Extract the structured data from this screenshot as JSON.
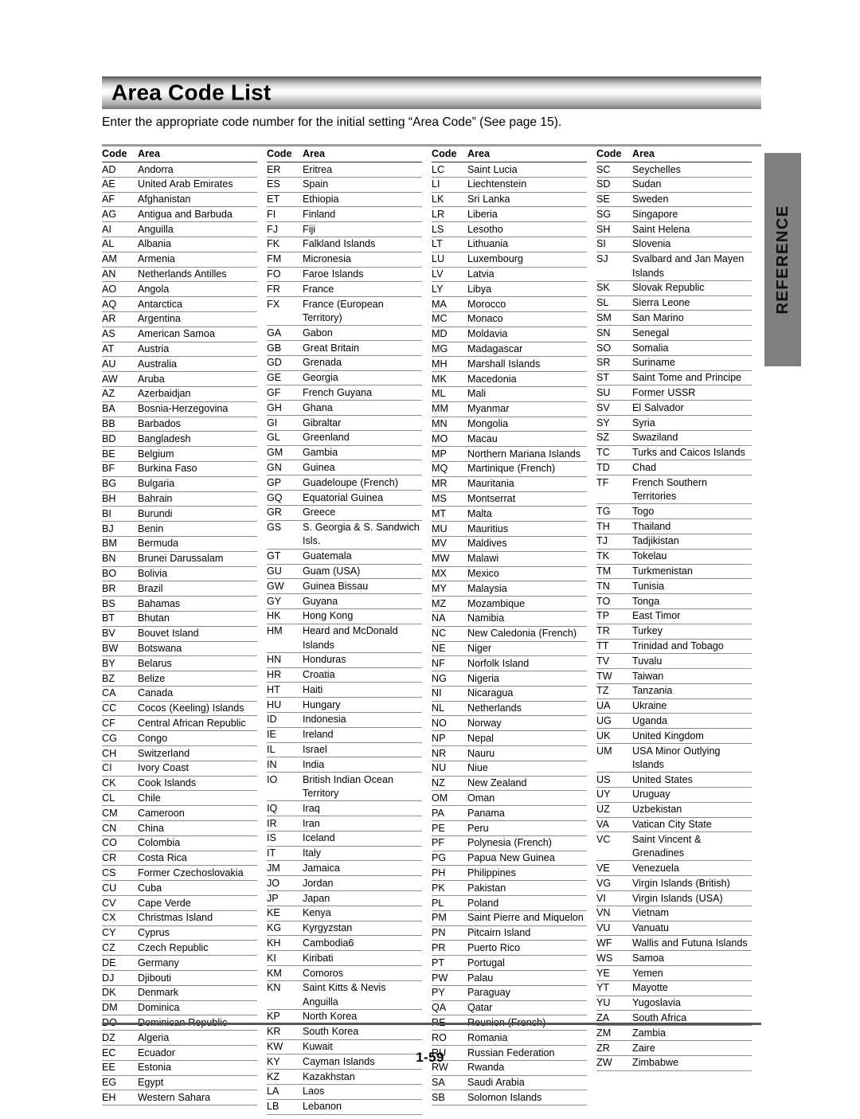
{
  "document": {
    "title": "Area Code List",
    "intro": "Enter the appropriate code number for the initial setting “Area Code” (See page 15).",
    "page_number": "1-59",
    "side_tab": "REFERENCE",
    "column_headers": {
      "code": "Code",
      "area": "Area"
    }
  },
  "columns": [
    {
      "rows": [
        {
          "code": "AD",
          "area": "Andorra"
        },
        {
          "code": "AE",
          "area": "United Arab Emirates"
        },
        {
          "code": "AF",
          "area": "Afghanistan"
        },
        {
          "code": "AG",
          "area": "Antigua and Barbuda"
        },
        {
          "code": "AI",
          "area": "Anguilla"
        },
        {
          "code": "AL",
          "area": "Albania"
        },
        {
          "code": "AM",
          "area": "Armenia"
        },
        {
          "code": "AN",
          "area": "Netherlands Antilles"
        },
        {
          "code": "AO",
          "area": "Angola"
        },
        {
          "code": "AQ",
          "area": "Antarctica"
        },
        {
          "code": "AR",
          "area": "Argentina"
        },
        {
          "code": "AS",
          "area": "American Samoa"
        },
        {
          "code": "AT",
          "area": "Austria"
        },
        {
          "code": "AU",
          "area": "Australia"
        },
        {
          "code": "AW",
          "area": "Aruba"
        },
        {
          "code": "AZ",
          "area": "Azerbaidjan"
        },
        {
          "code": "BA",
          "area": "Bosnia-Herzegovina"
        },
        {
          "code": "BB",
          "area": "Barbados"
        },
        {
          "code": "BD",
          "area": "Bangladesh"
        },
        {
          "code": "BE",
          "area": "Belgium"
        },
        {
          "code": "BF",
          "area": "Burkina Faso"
        },
        {
          "code": "BG",
          "area": "Bulgaria"
        },
        {
          "code": "BH",
          "area": "Bahrain"
        },
        {
          "code": "BI",
          "area": "Burundi"
        },
        {
          "code": "BJ",
          "area": "Benin"
        },
        {
          "code": "BM",
          "area": "Bermuda"
        },
        {
          "code": "BN",
          "area": "Brunei Darussalam"
        },
        {
          "code": "BO",
          "area": "Bolivia"
        },
        {
          "code": "BR",
          "area": "Brazil"
        },
        {
          "code": "BS",
          "area": "Bahamas"
        },
        {
          "code": "BT",
          "area": "Bhutan"
        },
        {
          "code": "BV",
          "area": "Bouvet Island"
        },
        {
          "code": "BW",
          "area": "Botswana"
        },
        {
          "code": "BY",
          "area": "Belarus"
        },
        {
          "code": "BZ",
          "area": "Belize"
        },
        {
          "code": "CA",
          "area": "Canada"
        },
        {
          "code": "CC",
          "area": "Cocos (Keeling) Islands"
        },
        {
          "code": "CF",
          "area": "Central African Republic"
        },
        {
          "code": "CG",
          "area": "Congo"
        },
        {
          "code": "CH",
          "area": "Switzerland"
        },
        {
          "code": "CI",
          "area": "Ivory Coast"
        },
        {
          "code": "CK",
          "area": "Cook Islands"
        },
        {
          "code": "CL",
          "area": "Chile"
        },
        {
          "code": "CM",
          "area": "Cameroon"
        },
        {
          "code": "CN",
          "area": "China"
        },
        {
          "code": "CO",
          "area": "Colombia"
        },
        {
          "code": "CR",
          "area": "Costa Rica"
        },
        {
          "code": "CS",
          "area": "Former Czechoslovakia"
        },
        {
          "code": "CU",
          "area": "Cuba"
        },
        {
          "code": "CV",
          "area": "Cape Verde"
        },
        {
          "code": "CX",
          "area": "Christmas Island"
        },
        {
          "code": "CY",
          "area": "Cyprus"
        },
        {
          "code": "CZ",
          "area": "Czech Republic"
        },
        {
          "code": "DE",
          "area": "Germany"
        },
        {
          "code": "DJ",
          "area": "Djibouti"
        },
        {
          "code": "DK",
          "area": "Denmark"
        },
        {
          "code": "DM",
          "area": "Dominica"
        },
        {
          "code": "DO",
          "area": "Dominican Republic"
        },
        {
          "code": "DZ",
          "area": "Algeria"
        },
        {
          "code": "EC",
          "area": "Ecuador"
        },
        {
          "code": "EE",
          "area": "Estonia"
        },
        {
          "code": "EG",
          "area": "Egypt"
        },
        {
          "code": "EH",
          "area": "Western Sahara"
        }
      ]
    },
    {
      "rows": [
        {
          "code": "ER",
          "area": "Eritrea"
        },
        {
          "code": "ES",
          "area": "Spain"
        },
        {
          "code": "ET",
          "area": "Ethiopia"
        },
        {
          "code": "FI",
          "area": "Finland"
        },
        {
          "code": "FJ",
          "area": "Fiji"
        },
        {
          "code": "FK",
          "area": "Falkland Islands"
        },
        {
          "code": "FM",
          "area": "Micronesia"
        },
        {
          "code": "FO",
          "area": "Faroe Islands"
        },
        {
          "code": "FR",
          "area": "France"
        },
        {
          "code": "FX",
          "area": "France (European Territory)"
        },
        {
          "code": "GA",
          "area": "Gabon"
        },
        {
          "code": "GB",
          "area": "Great Britain"
        },
        {
          "code": "GD",
          "area": "Grenada"
        },
        {
          "code": "GE",
          "area": "Georgia"
        },
        {
          "code": "GF",
          "area": "French Guyana"
        },
        {
          "code": "GH",
          "area": "Ghana"
        },
        {
          "code": "GI",
          "area": "Gibraltar"
        },
        {
          "code": "GL",
          "area": "Greenland"
        },
        {
          "code": "GM",
          "area": "Gambia"
        },
        {
          "code": "GN",
          "area": "Guinea"
        },
        {
          "code": "GP",
          "area": "Guadeloupe (French)"
        },
        {
          "code": "GQ",
          "area": "Equatorial Guinea"
        },
        {
          "code": "GR",
          "area": "Greece"
        },
        {
          "code": "GS",
          "area": "S. Georgia & S. Sandwich Isls."
        },
        {
          "code": "GT",
          "area": "Guatemala"
        },
        {
          "code": "GU",
          "area": "Guam (USA)"
        },
        {
          "code": "GW",
          "area": "Guinea Bissau"
        },
        {
          "code": "GY",
          "area": "Guyana"
        },
        {
          "code": "HK",
          "area": "Hong Kong"
        },
        {
          "code": "HM",
          "area": "Heard and McDonald Islands"
        },
        {
          "code": "HN",
          "area": "Honduras"
        },
        {
          "code": "HR",
          "area": "Croatia"
        },
        {
          "code": "HT",
          "area": "Haiti"
        },
        {
          "code": "HU",
          "area": "Hungary"
        },
        {
          "code": "ID",
          "area": "Indonesia"
        },
        {
          "code": "IE",
          "area": "Ireland"
        },
        {
          "code": "IL",
          "area": "Israel"
        },
        {
          "code": "IN",
          "area": "India"
        },
        {
          "code": "IO",
          "area": "British Indian Ocean Territory"
        },
        {
          "code": "IQ",
          "area": "Iraq"
        },
        {
          "code": "IR",
          "area": "Iran"
        },
        {
          "code": "IS",
          "area": "Iceland"
        },
        {
          "code": "IT",
          "area": "Italy"
        },
        {
          "code": "JM",
          "area": "Jamaica"
        },
        {
          "code": "JO",
          "area": "Jordan"
        },
        {
          "code": "JP",
          "area": "Japan"
        },
        {
          "code": "KE",
          "area": "Kenya"
        },
        {
          "code": "KG",
          "area": "Kyrgyzstan"
        },
        {
          "code": "KH",
          "area": "Cambodia6"
        },
        {
          "code": "KI",
          "area": "Kiribati"
        },
        {
          "code": "KM",
          "area": "Comoros"
        },
        {
          "code": "KN",
          "area": "Saint Kitts & Nevis Anguilla"
        },
        {
          "code": "KP",
          "area": "North Korea"
        },
        {
          "code": "KR",
          "area": "South Korea"
        },
        {
          "code": "KW",
          "area": "Kuwait"
        },
        {
          "code": "KY",
          "area": "Cayman Islands"
        },
        {
          "code": "KZ",
          "area": "Kazakhstan"
        },
        {
          "code": "LA",
          "area": "Laos"
        },
        {
          "code": "LB",
          "area": "Lebanon"
        }
      ]
    },
    {
      "rows": [
        {
          "code": "LC",
          "area": "Saint Lucia"
        },
        {
          "code": "LI",
          "area": "Liechtenstein"
        },
        {
          "code": "LK",
          "area": "Sri Lanka"
        },
        {
          "code": "LR",
          "area": "Liberia"
        },
        {
          "code": "LS",
          "area": "Lesotho"
        },
        {
          "code": "LT",
          "area": "Lithuania"
        },
        {
          "code": "LU",
          "area": "Luxembourg"
        },
        {
          "code": "LV",
          "area": "Latvia"
        },
        {
          "code": "LY",
          "area": "Libya"
        },
        {
          "code": "MA",
          "area": "Morocco"
        },
        {
          "code": "MC",
          "area": "Monaco"
        },
        {
          "code": "MD",
          "area": "Moldavia"
        },
        {
          "code": "MG",
          "area": "Madagascar"
        },
        {
          "code": "MH",
          "area": "Marshall Islands"
        },
        {
          "code": "MK",
          "area": "Macedonia"
        },
        {
          "code": "ML",
          "area": "Mali"
        },
        {
          "code": "MM",
          "area": "Myanmar"
        },
        {
          "code": "MN",
          "area": "Mongolia"
        },
        {
          "code": "MO",
          "area": "Macau"
        },
        {
          "code": "MP",
          "area": "Northern Mariana Islands"
        },
        {
          "code": "MQ",
          "area": "Martinique (French)"
        },
        {
          "code": "MR",
          "area": "Mauritania"
        },
        {
          "code": "MS",
          "area": "Montserrat"
        },
        {
          "code": "MT",
          "area": "Malta"
        },
        {
          "code": "MU",
          "area": "Mauritius"
        },
        {
          "code": "MV",
          "area": "Maldives"
        },
        {
          "code": "MW",
          "area": "Malawi"
        },
        {
          "code": "MX",
          "area": "Mexico"
        },
        {
          "code": "MY",
          "area": "Malaysia"
        },
        {
          "code": "MZ",
          "area": "Mozambique"
        },
        {
          "code": "NA",
          "area": "Namibia"
        },
        {
          "code": "NC",
          "area": "New Caledonia (French)"
        },
        {
          "code": "NE",
          "area": "Niger"
        },
        {
          "code": "NF",
          "area": "Norfolk Island"
        },
        {
          "code": "NG",
          "area": "Nigeria"
        },
        {
          "code": "NI",
          "area": "Nicaragua"
        },
        {
          "code": "NL",
          "area": "Netherlands"
        },
        {
          "code": "NO",
          "area": "Norway"
        },
        {
          "code": "NP",
          "area": "Nepal"
        },
        {
          "code": "NR",
          "area": "Nauru"
        },
        {
          "code": "NU",
          "area": "Niue"
        },
        {
          "code": "NZ",
          "area": "New Zealand"
        },
        {
          "code": "OM",
          "area": "Oman"
        },
        {
          "code": "PA",
          "area": "Panama"
        },
        {
          "code": "PE",
          "area": "Peru"
        },
        {
          "code": "PF",
          "area": "Polynesia (French)"
        },
        {
          "code": "PG",
          "area": "Papua New Guinea"
        },
        {
          "code": "PH",
          "area": "Philippines"
        },
        {
          "code": "PK",
          "area": "Pakistan"
        },
        {
          "code": "PL",
          "area": "Poland"
        },
        {
          "code": "PM",
          "area": "Saint Pierre and Miquelon"
        },
        {
          "code": "PN",
          "area": "Pitcairn Island"
        },
        {
          "code": "PR",
          "area": "Puerto Rico"
        },
        {
          "code": "PT",
          "area": "Portugal"
        },
        {
          "code": "PW",
          "area": "Palau"
        },
        {
          "code": "PY",
          "area": "Paraguay"
        },
        {
          "code": "QA",
          "area": "Qatar"
        },
        {
          "code": "RE",
          "area": "Reunion (French)"
        },
        {
          "code": "RO",
          "area": "Romania"
        },
        {
          "code": "RU",
          "area": "Russian Federation"
        },
        {
          "code": "RW",
          "area": "Rwanda"
        },
        {
          "code": "SA",
          "area": "Saudi Arabia"
        },
        {
          "code": "SB",
          "area": "Solomon Islands"
        }
      ]
    },
    {
      "rows": [
        {
          "code": "SC",
          "area": "Seychelles"
        },
        {
          "code": "SD",
          "area": "Sudan"
        },
        {
          "code": "SE",
          "area": "Sweden"
        },
        {
          "code": "SG",
          "area": "Singapore"
        },
        {
          "code": "SH",
          "area": "Saint Helena"
        },
        {
          "code": "SI",
          "area": "Slovenia"
        },
        {
          "code": "SJ",
          "area": "Svalbard and Jan Mayen Islands"
        },
        {
          "code": "SK",
          "area": "Slovak Republic"
        },
        {
          "code": "SL",
          "area": "Sierra Leone"
        },
        {
          "code": "SM",
          "area": "San Marino"
        },
        {
          "code": "SN",
          "area": "Senegal"
        },
        {
          "code": "SO",
          "area": "Somalia"
        },
        {
          "code": "SR",
          "area": "Suriname"
        },
        {
          "code": "ST",
          "area": "Saint Tome and Principe"
        },
        {
          "code": "SU",
          "area": "Former USSR"
        },
        {
          "code": "SV",
          "area": "El Salvador"
        },
        {
          "code": "SY",
          "area": "Syria"
        },
        {
          "code": "SZ",
          "area": "Swaziland"
        },
        {
          "code": "TC",
          "area": "Turks and Caicos Islands"
        },
        {
          "code": "TD",
          "area": "Chad"
        },
        {
          "code": "TF",
          "area": "French Southern Territories"
        },
        {
          "code": "TG",
          "area": "Togo"
        },
        {
          "code": "TH",
          "area": "Thailand"
        },
        {
          "code": "TJ",
          "area": "Tadjikistan"
        },
        {
          "code": "TK",
          "area": "Tokelau"
        },
        {
          "code": "TM",
          "area": "Turkmenistan"
        },
        {
          "code": "TN",
          "area": "Tunisia"
        },
        {
          "code": "TO",
          "area": "Tonga"
        },
        {
          "code": "TP",
          "area": "East Timor"
        },
        {
          "code": "TR",
          "area": "Turkey"
        },
        {
          "code": "TT",
          "area": "Trinidad and Tobago"
        },
        {
          "code": "TV",
          "area": "Tuvalu"
        },
        {
          "code": "TW",
          "area": "Taiwan"
        },
        {
          "code": "TZ",
          "area": "Tanzania"
        },
        {
          "code": "UA",
          "area": "Ukraine"
        },
        {
          "code": "UG",
          "area": "Uganda"
        },
        {
          "code": "UK",
          "area": "United Kingdom"
        },
        {
          "code": "UM",
          "area": "USA Minor Outlying Islands"
        },
        {
          "code": "US",
          "area": "United States"
        },
        {
          "code": "UY",
          "area": "Uruguay"
        },
        {
          "code": "UZ",
          "area": "Uzbekistan"
        },
        {
          "code": "VA",
          "area": "Vatican City State"
        },
        {
          "code": "VC",
          "area": "Saint Vincent & Grenadines"
        },
        {
          "code": "VE",
          "area": "Venezuela"
        },
        {
          "code": "VG",
          "area": "Virgin Islands (British)"
        },
        {
          "code": "VI",
          "area": "Virgin Islands (USA)"
        },
        {
          "code": "VN",
          "area": "Vietnam"
        },
        {
          "code": "VU",
          "area": "Vanuatu"
        },
        {
          "code": "WF",
          "area": "Wallis and Futuna Islands"
        },
        {
          "code": "WS",
          "area": "Samoa"
        },
        {
          "code": "YE",
          "area": "Yemen"
        },
        {
          "code": "YT",
          "area": "Mayotte"
        },
        {
          "code": "YU",
          "area": "Yugoslavia"
        },
        {
          "code": "ZA",
          "area": "South Africa"
        },
        {
          "code": "ZM",
          "area": "Zambia"
        },
        {
          "code": "ZR",
          "area": "Zaire"
        },
        {
          "code": "ZW",
          "area": "Zimbabwe"
        }
      ]
    }
  ]
}
